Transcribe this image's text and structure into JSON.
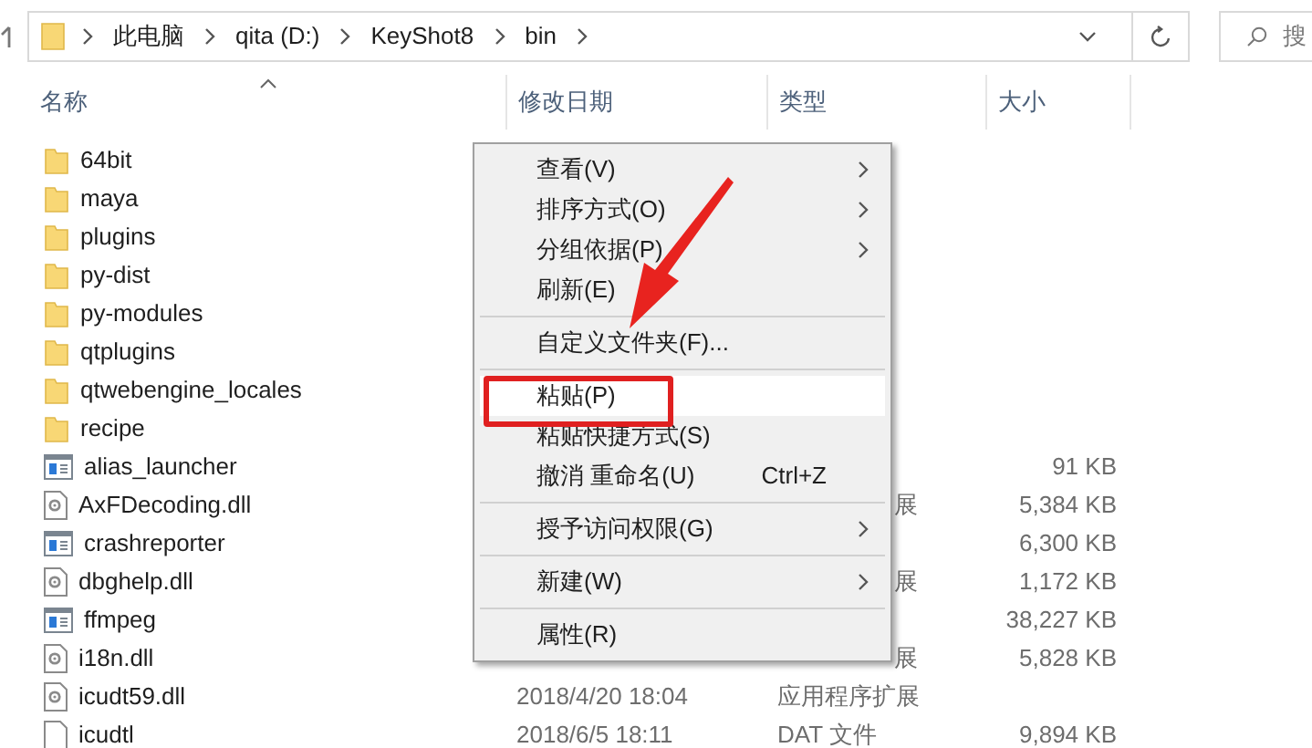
{
  "address_bar": {
    "path": [
      "此电脑",
      "qita (D:)",
      "KeyShot8",
      "bin"
    ]
  },
  "search": {
    "placeholder": "搜"
  },
  "columns": [
    "名称",
    "修改日期",
    "类型",
    "大小"
  ],
  "files": [
    {
      "name": "64bit",
      "kind": "folder"
    },
    {
      "name": "maya",
      "kind": "folder"
    },
    {
      "name": "plugins",
      "kind": "folder"
    },
    {
      "name": "py-dist",
      "kind": "folder"
    },
    {
      "name": "py-modules",
      "kind": "folder"
    },
    {
      "name": "qtplugins",
      "kind": "folder"
    },
    {
      "name": "qtwebengine_locales",
      "kind": "folder"
    },
    {
      "name": "recipe",
      "kind": "folder"
    },
    {
      "name": "alias_launcher",
      "kind": "exe",
      "size": "91 KB"
    },
    {
      "name": "AxFDecoding.dll",
      "kind": "dll",
      "type": "展",
      "size": "5,384 KB"
    },
    {
      "name": "crashreporter",
      "kind": "exe",
      "size": "6,300 KB"
    },
    {
      "name": "dbghelp.dll",
      "kind": "dll",
      "type": "展",
      "size": "1,172 KB"
    },
    {
      "name": "ffmpeg",
      "kind": "exe",
      "size": "38,227 KB"
    },
    {
      "name": "i18n.dll",
      "kind": "dll",
      "type": "展",
      "size": "5,828 KB"
    },
    {
      "name": "icudt59.dll",
      "kind": "dll",
      "date": "2018/4/20 18:04",
      "type": "应用程序扩展"
    },
    {
      "name": "icudtl",
      "kind": "dat",
      "date": "2018/6/5 18:11",
      "type": "DAT 文件",
      "size": "9,894 KB"
    }
  ],
  "context_menu": {
    "groups": [
      [
        {
          "label": "查看(V)",
          "submenu": true,
          "selected": false
        },
        {
          "label": "排序方式(O)",
          "submenu": true,
          "selected": false
        },
        {
          "label": "分组依据(P)",
          "submenu": true,
          "selected": false
        },
        {
          "label": "刷新(E)",
          "submenu": false,
          "selected": false
        }
      ],
      [
        {
          "label": "自定义文件夹(F)...",
          "submenu": false,
          "selected": false
        }
      ],
      [
        {
          "label": "粘贴(P)",
          "submenu": false,
          "selected": true
        },
        {
          "label": "粘贴快捷方式(S)",
          "submenu": false,
          "selected": false
        },
        {
          "label": "撤消 重命名(U)",
          "shortcut": "Ctrl+Z",
          "submenu": false,
          "selected": false
        }
      ],
      [
        {
          "label": "授予访问权限(G)",
          "submenu": true,
          "selected": false
        }
      ],
      [
        {
          "label": "新建(W)",
          "submenu": true,
          "selected": false
        }
      ],
      [
        {
          "label": "属性(R)",
          "submenu": false,
          "selected": false
        }
      ]
    ]
  }
}
